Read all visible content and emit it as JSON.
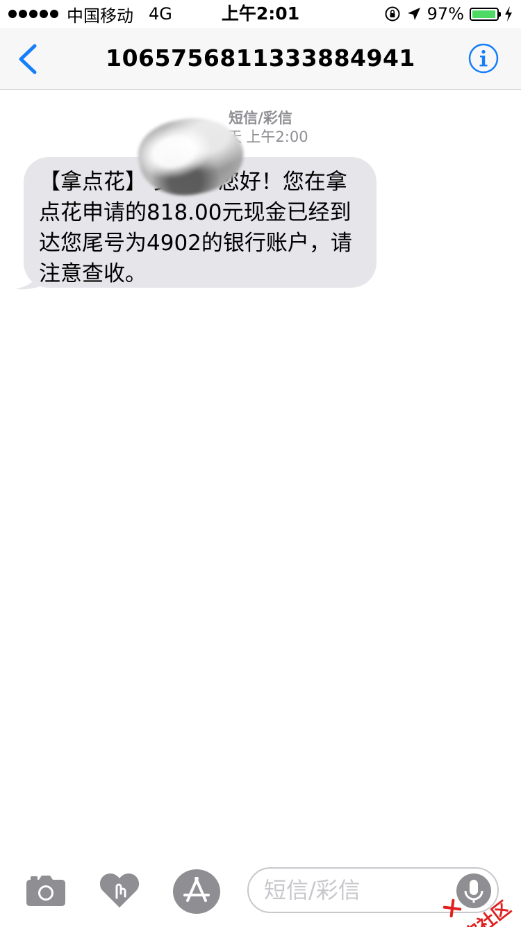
{
  "status_bar": {
    "carrier": "中国移动",
    "network": "4G",
    "time": "上午2:01",
    "battery_percent": "97%",
    "battery_level": 0.97,
    "icons": [
      "signal-dots",
      "rotation-lock-icon",
      "location-arrow-icon",
      "battery-icon",
      "charging-bolt-icon"
    ]
  },
  "nav": {
    "back_icon": "chevron-left-icon",
    "title": "10657568113338849​41",
    "info_icon": "info-icon"
  },
  "conversation": {
    "message_type": "短信/彩信",
    "timestamp_day": "今天",
    "timestamp_time": "上午2:00",
    "messages": [
      {
        "direction": "incoming",
        "text": "【拿点花】        女士，您好！您在拿点花申请的818.00元现金已经到达您尾号为4902的银行账户，请注意查收。"
      }
    ]
  },
  "input_bar": {
    "placeholder": "短信/彩信",
    "value": "",
    "icons": [
      "camera-icon",
      "digital-touch-icon",
      "app-store-icon",
      "microphone-icon"
    ]
  },
  "watermark": {
    "text": "卡农社区"
  },
  "colors": {
    "accent": "#147efb",
    "incoming_bubble": "#e5e5ea",
    "battery": "#4cd964",
    "meta_text": "#8e8e93",
    "watermark": "#e02020"
  }
}
